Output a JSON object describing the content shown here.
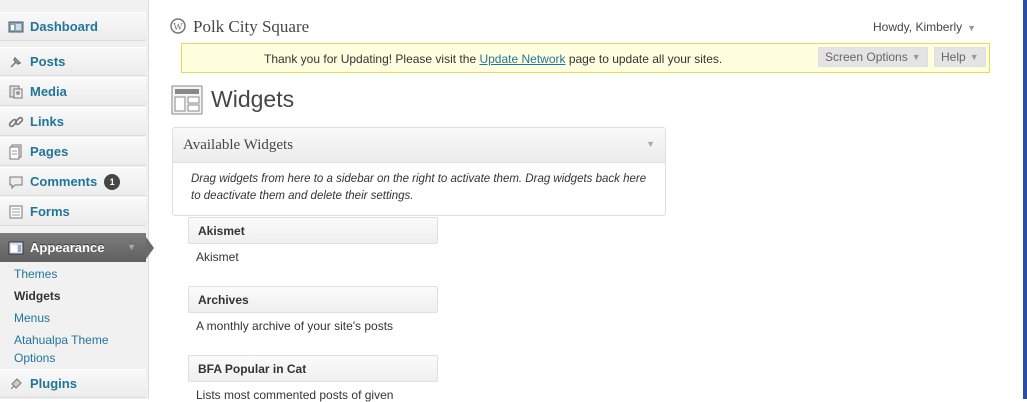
{
  "sidebar": {
    "items": [
      {
        "label": "Dashboard",
        "icon": "dashboard-icon"
      },
      {
        "label": "Posts",
        "icon": "pin-icon"
      },
      {
        "label": "Media",
        "icon": "media-icon"
      },
      {
        "label": "Links",
        "icon": "link-icon"
      },
      {
        "label": "Pages",
        "icon": "pages-icon"
      },
      {
        "label": "Comments",
        "icon": "comment-icon",
        "badge": "1"
      },
      {
        "label": "Forms",
        "icon": "forms-icon"
      }
    ],
    "appearance": {
      "label": "Appearance",
      "icon": "appearance-icon"
    },
    "submenu": [
      "Themes",
      "Widgets",
      "Menus",
      "Atahualpa Theme",
      "Options"
    ],
    "plugins": {
      "label": "Plugins",
      "icon": "plugin-icon"
    }
  },
  "header": {
    "site_title": "Polk City Square",
    "howdy": "Howdy, Kimberly"
  },
  "notice": {
    "before": "Thank you for Updating! Please visit the ",
    "link": "Update Network",
    "after": " page to update all your sites."
  },
  "tabs": {
    "screen_options": "Screen Options",
    "help": "Help"
  },
  "page": {
    "title": "Widgets"
  },
  "available": {
    "title": "Available Widgets",
    "description": "Drag widgets from here to a sidebar on the right to activate them. Drag widgets back here to deactivate them and delete their settings."
  },
  "widgets": [
    {
      "name": "Akismet",
      "desc": "Akismet"
    },
    {
      "name": "Archives",
      "desc": "A monthly archive of your site's posts"
    },
    {
      "name": "BFA Popular in Cat",
      "desc": "Lists most commented posts of given"
    }
  ],
  "colors": {
    "link": "#21759b",
    "notice_bg": "#ffffe0",
    "sidebar_active": "#6a6a6a"
  }
}
